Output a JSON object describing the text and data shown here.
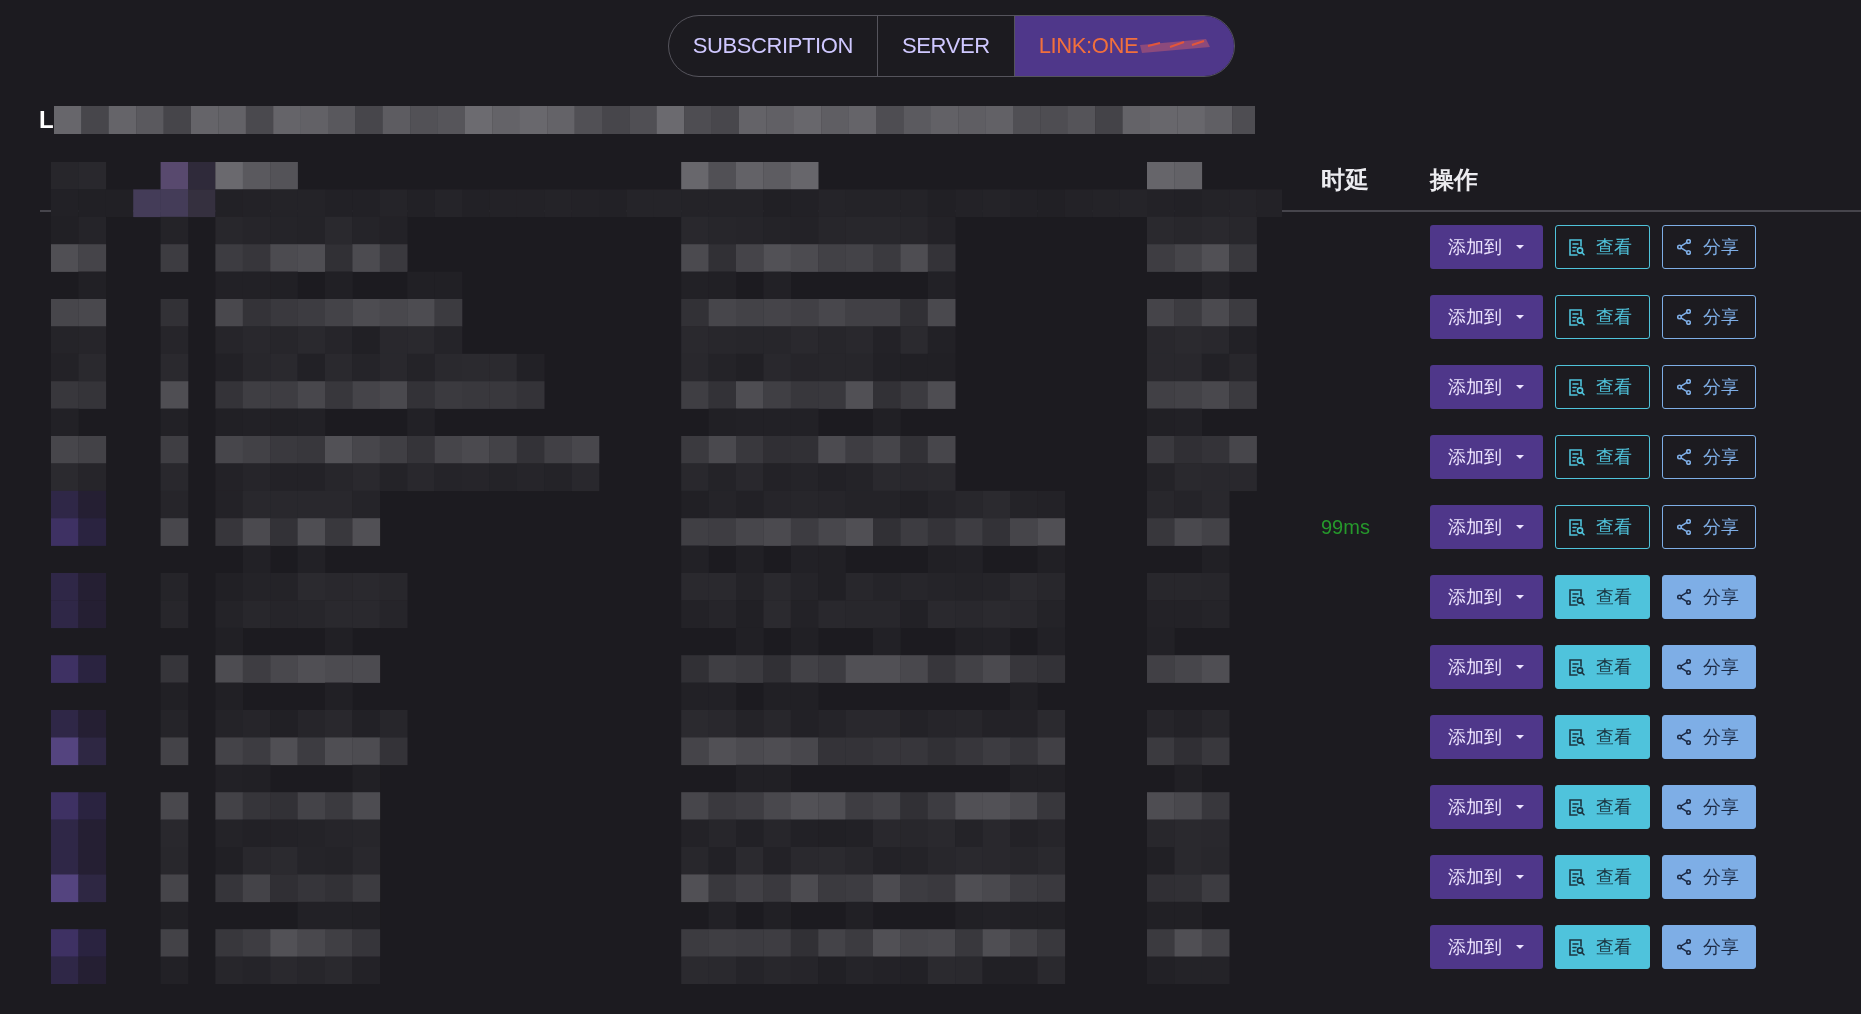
{
  "tabs": [
    {
      "label": "SUBSCRIPTION",
      "selected": false,
      "redacted": false
    },
    {
      "label": "SERVER",
      "selected": false,
      "redacted": false
    },
    {
      "label": "LINK:ONE",
      "selected": true,
      "redacted": true
    }
  ],
  "heading": "L",
  "table": {
    "columns": [
      "时延",
      "操作"
    ],
    "rows": [
      {
        "kind": "outline",
        "buttons": [
          {
            "kind": "dropdown",
            "label": "添加到"
          },
          {
            "kind": "view",
            "label": "查看"
          },
          {
            "kind": "share",
            "label": "分享"
          }
        ]
      },
      {
        "kind": "outline",
        "buttons": [
          {
            "kind": "dropdown",
            "label": "添加到"
          },
          {
            "kind": "view",
            "label": "查看"
          },
          {
            "kind": "share",
            "label": "分享"
          }
        ]
      },
      {
        "kind": "outline",
        "buttons": [
          {
            "kind": "dropdown",
            "label": "添加到"
          },
          {
            "kind": "view",
            "label": "查看"
          },
          {
            "kind": "share",
            "label": "分享"
          }
        ]
      },
      {
        "kind": "outline",
        "buttons": [
          {
            "kind": "dropdown",
            "label": "添加到"
          },
          {
            "kind": "view",
            "label": "查看"
          },
          {
            "kind": "share",
            "label": "分享"
          }
        ]
      },
      {
        "kind": "outline",
        "latency": "99ms",
        "buttons": [
          {
            "kind": "dropdown",
            "label": "添加到"
          },
          {
            "kind": "view",
            "label": "查看"
          },
          {
            "kind": "share",
            "label": "分享"
          }
        ]
      },
      {
        "kind": "solid",
        "buttons": [
          {
            "kind": "dropdown",
            "label": "添加到"
          },
          {
            "kind": "view",
            "label": "查看"
          },
          {
            "kind": "share",
            "label": "分享"
          }
        ]
      },
      {
        "kind": "solid",
        "buttons": [
          {
            "kind": "dropdown",
            "label": "添加到"
          },
          {
            "kind": "view",
            "label": "查看"
          },
          {
            "kind": "share",
            "label": "分享"
          }
        ]
      },
      {
        "kind": "solid",
        "buttons": [
          {
            "kind": "dropdown",
            "label": "添加到"
          },
          {
            "kind": "view",
            "label": "查看"
          },
          {
            "kind": "share",
            "label": "分享"
          }
        ]
      },
      {
        "kind": "solid",
        "buttons": [
          {
            "kind": "dropdown",
            "label": "添加到"
          },
          {
            "kind": "view",
            "label": "查看"
          },
          {
            "kind": "share",
            "label": "分享"
          }
        ]
      },
      {
        "kind": "solid",
        "buttons": [
          {
            "kind": "dropdown",
            "label": "添加到"
          },
          {
            "kind": "view",
            "label": "查看"
          },
          {
            "kind": "share",
            "label": "分享"
          }
        ]
      },
      {
        "kind": "solid",
        "buttons": [
          {
            "kind": "dropdown",
            "label": "添加到"
          },
          {
            "kind": "view",
            "label": "查看"
          },
          {
            "kind": "share",
            "label": "分享"
          }
        ]
      }
    ]
  }
}
